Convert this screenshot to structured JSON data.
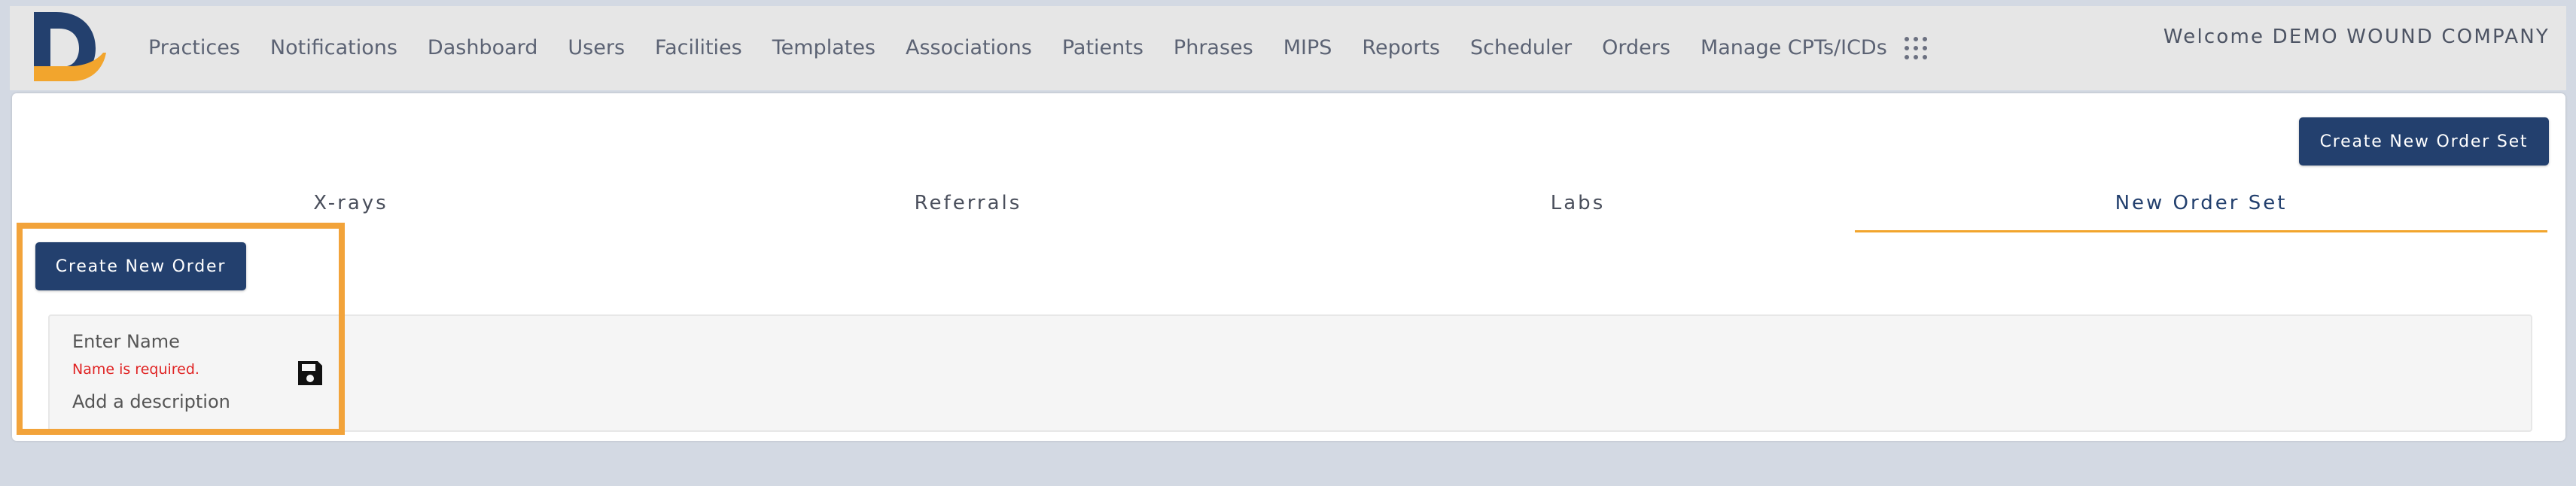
{
  "nav": {
    "items": [
      "Practices",
      "Notifications",
      "Dashboard",
      "Users",
      "Facilities",
      "Templates",
      "Associations",
      "Patients",
      "Phrases",
      "MIPS",
      "Reports",
      "Scheduler",
      "Orders",
      "Manage CPTs/ICDs"
    ]
  },
  "header": {
    "welcome": "Welcome DEMO WOUND COMPANY"
  },
  "actions": {
    "create_order_set": "Create New Order Set",
    "create_order": "Create New Order"
  },
  "tabs": [
    {
      "label": "X-rays",
      "active": false
    },
    {
      "label": "Referrals",
      "active": false
    },
    {
      "label": "Labs",
      "active": false
    },
    {
      "label": "New Order Set",
      "active": true
    }
  ],
  "form": {
    "name_placeholder": "Enter Name",
    "name_error": "Name is required.",
    "description_placeholder": "Add a description"
  },
  "colors": {
    "primary": "#23406e",
    "accent": "#f2a52d",
    "error": "#e02424"
  },
  "icons": {
    "apps": "grid-dots-icon",
    "save": "floppy-disk-icon",
    "logo": "d-logo"
  }
}
